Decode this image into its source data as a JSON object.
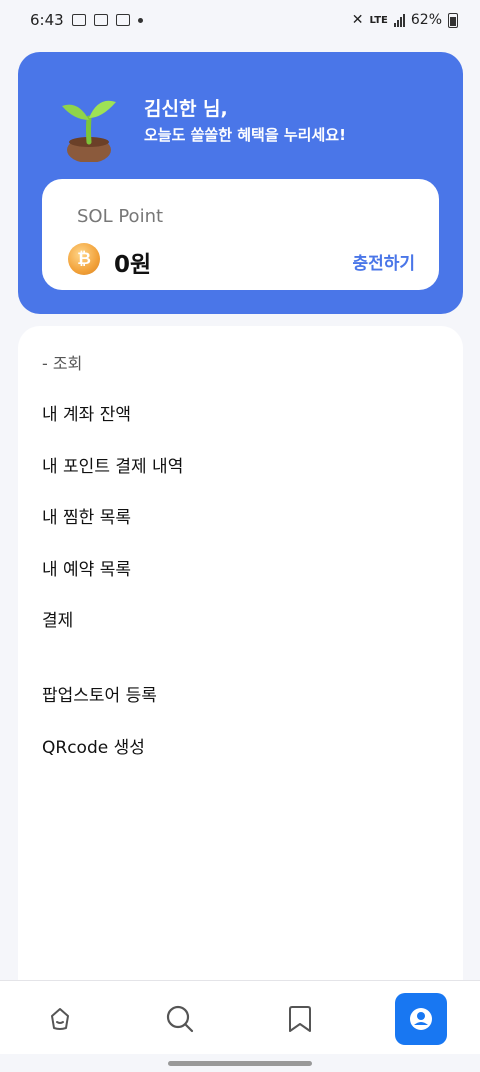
{
  "status_bar": {
    "time": "6:43",
    "network": "LTE",
    "battery": "62%"
  },
  "hero": {
    "name_line": "김신한 님,",
    "sub_line": "오늘도 쏠쏠한 혜택을 누리세요!",
    "accent_color": "#4a76e8"
  },
  "points": {
    "title": "SOL Point",
    "coin_symbol": "₿",
    "value": "0원",
    "charge_label": "충전하기"
  },
  "menu": {
    "section_label": "- 조회",
    "items": [
      {
        "label": "내 계좌 잔액"
      },
      {
        "label": "내 포인트 결제 내역"
      },
      {
        "label": "내 찜한 목록"
      },
      {
        "label": "내 예약 목록"
      },
      {
        "label": "결제"
      },
      {
        "label": "팝업스토어 등록"
      },
      {
        "label": "QRcode 생성"
      }
    ]
  },
  "bottom_nav": {
    "items": [
      {
        "icon": "home-icon"
      },
      {
        "icon": "search-icon"
      },
      {
        "icon": "bookmark-icon"
      },
      {
        "icon": "profile-icon",
        "active": true
      }
    ],
    "active_color": "#1877f2"
  }
}
